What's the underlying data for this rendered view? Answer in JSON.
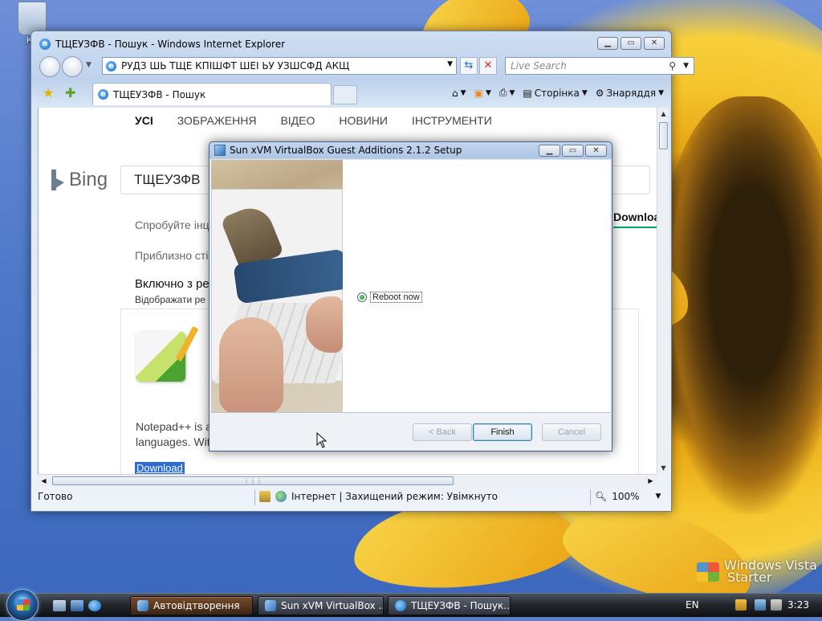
{
  "desktop": {
    "recycle_label": "Ко",
    "watermark_line1": "Windows Vista",
    "watermark_line2": "Starter"
  },
  "ie": {
    "title": "ТЩЕУЗФВ - Пошук - Windows Internet Explorer",
    "address": "РУДЗ ШЬ ТЩЕ КПІШФТ ШЕІ ЬУ УЗШСФД АКЩ",
    "search_placeholder": "Live Search",
    "tab_label": "ТЩЕУЗФВ - Пошук",
    "cmd_page": "Сторінка",
    "cmd_tools": "Знаряддя",
    "status_ready": "Готово",
    "status_zone": "Інтернет | Захищений режим: Увімкнуто",
    "zoom": "100%"
  },
  "bing": {
    "nav": [
      "УСІ",
      "ЗОБРАЖЕННЯ",
      "ВІДЕО",
      "НОВИНИ",
      "ІНСТРУМЕНТИ"
    ],
    "logo_text": "Bing",
    "query": "ТЩЕУЗФВ",
    "try_text": "Спробуйте інц",
    "approx_text": "Приблизно сті",
    "include_text": "Включно з ре",
    "show_text": "Відображати ре",
    "download_tab": "Downloa",
    "result_line1": "Notepad++ is a",
    "result_line2": "languages. Wit",
    "download_link": "Download"
  },
  "dialog": {
    "title": "Sun xVM VirtualBox Guest Additions 2.1.2 Setup",
    "radio_label": "Reboot now",
    "back": "< Back",
    "finish": "Finish",
    "cancel": "Cancel"
  },
  "taskbar": {
    "tasks": [
      {
        "label": "Автовідтворення",
        "active": true
      },
      {
        "label": "Sun xVM VirtualBox ...",
        "active": false
      },
      {
        "label": "ТЩЕУЗФВ - Пошук...",
        "active": false
      }
    ],
    "lang": "EN",
    "time": "3:23"
  }
}
